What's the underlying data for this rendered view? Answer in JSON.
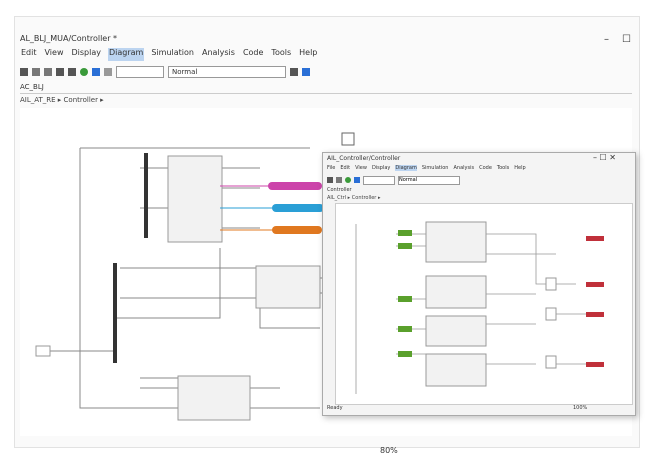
{
  "window": {
    "title": "AL_BLJ_MUA/Controller *",
    "menu": [
      "Edit",
      "View",
      "Display",
      "Diagram",
      "Simulation",
      "Analysis",
      "Code",
      "Tools",
      "Help"
    ],
    "active_menu": "Diagram",
    "minimize_glyph": "–",
    "maximize_glyph": "☐",
    "toolbar_select_value": "Normal",
    "model_tab": "AC_BLJ",
    "breadcrumb": "AIL_AT_RE ▸ Controller ▸",
    "zoom": "80%"
  },
  "inner_window": {
    "title": "AIL_Controller/Controller",
    "menu": [
      "File",
      "Edit",
      "View",
      "Display",
      "Diagram",
      "Simulation",
      "Analysis",
      "Code",
      "Tools",
      "Help"
    ],
    "toolbar_select_value": "Normal",
    "model_tab": "Controller",
    "breadcrumb": "AIL_Ctrl ▸ Controller ▸",
    "status_left": "Ready",
    "status_right": "100%"
  },
  "colors": {
    "pink": "#cc44aa",
    "cyan": "#2a9fd6",
    "orange": "#e07820",
    "green": "#5aa02c",
    "red": "#c0303a",
    "bus": "#333333"
  },
  "icons": [
    "save-icon",
    "undo-icon",
    "redo-icon",
    "run-icon",
    "stop-icon",
    "step-icon",
    "zoom-icon"
  ]
}
